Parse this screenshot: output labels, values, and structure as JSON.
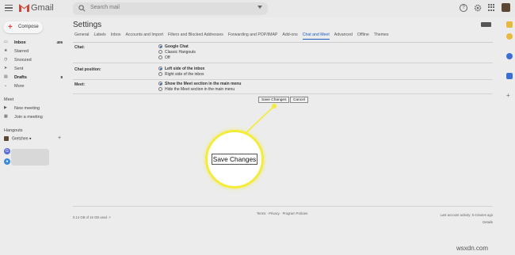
{
  "topbar": {
    "app_name": "Gmail",
    "search_placeholder": "Search mail"
  },
  "sidebar": {
    "compose_label": "Compose",
    "items": [
      {
        "label": "Inbox",
        "count": "405",
        "bold": true
      },
      {
        "label": "Starred",
        "count": ""
      },
      {
        "label": "Snoozed",
        "count": ""
      },
      {
        "label": "Sent",
        "count": ""
      },
      {
        "label": "Drafts",
        "count": "8",
        "bold": true
      },
      {
        "label": "More",
        "count": ""
      }
    ],
    "meet_label": "Meet",
    "meet_items": [
      {
        "label": "New meeting"
      },
      {
        "label": "Join a meeting"
      }
    ],
    "hangouts_label": "Hangouts",
    "hangouts_user": "Gretchen"
  },
  "main": {
    "title": "Settings",
    "tabs": [
      {
        "label": "General"
      },
      {
        "label": "Labels"
      },
      {
        "label": "Inbox"
      },
      {
        "label": "Accounts and Import"
      },
      {
        "label": "Filters and Blocked Addresses"
      },
      {
        "label": "Forwarding and POP/IMAP"
      },
      {
        "label": "Add-ons"
      },
      {
        "label": "Chat and Meet",
        "active": true
      },
      {
        "label": "Advanced"
      },
      {
        "label": "Offline"
      },
      {
        "label": "Themes"
      }
    ],
    "chat": {
      "label": "Chat:",
      "options": [
        "Google Chat",
        "Classic Hangouts",
        "Off"
      ],
      "selected": "Google Chat"
    },
    "chat_position": {
      "label": "Chat position:",
      "options": [
        "Left side of the inbox",
        "Right side of the inbox"
      ],
      "selected": "Left side of the inbox"
    },
    "meet": {
      "label": "Meet:",
      "options": [
        "Show the Meet section in the main menu",
        "Hide the Meet section in the main menu"
      ],
      "selected": "Show the Meet section in the main menu"
    },
    "save_label": "Save Changes",
    "cancel_label": "Cancel",
    "footer": {
      "storage": "0.14 GB of 15 GB used",
      "links": "Terms · Privacy · Program Policies",
      "activity": "Last account activity: 5 minutes ago",
      "details": "Details"
    }
  },
  "callout": {
    "label": "Save Changes"
  },
  "watermark": "wsxdn.com",
  "colors": {
    "accent": "#1a5fbf",
    "highlight": "#f3ec3a"
  }
}
